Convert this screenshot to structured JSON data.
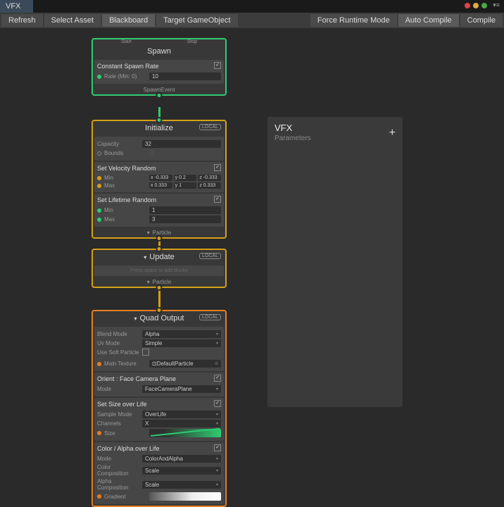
{
  "tab": "VFX",
  "toolbar": {
    "refresh": "Refresh",
    "selectAsset": "Select Asset",
    "blackboard": "Blackboard",
    "targetGO": "Target GameObject",
    "forceRuntime": "Force Runtime Mode",
    "autoCompile": "Auto Compile",
    "compile": "Compile"
  },
  "spawn": {
    "start": "Start",
    "stop": "Stop",
    "title": "Spawn",
    "section": "Constant Spawn Rate",
    "rateLabel": "Rate (Min: 0)",
    "rateVal": "10",
    "footer": "SpawnEvent"
  },
  "init": {
    "title": "Initialize",
    "badge": "LOCAL",
    "capLabel": "Capacity",
    "capVal": "32",
    "boundsLabel": "Bounds",
    "velSection": "Set Velocity Random",
    "min": "Min",
    "max": "Max",
    "vmin": {
      "x": "x -0.333",
      "y": "y 0.2",
      "z": "z -0.333"
    },
    "vmax": {
      "x": "x 0.333",
      "y": "y 1",
      "z": "z 0.333"
    },
    "lifeSection": "Set Lifetime Random",
    "lmin": "1",
    "lmax": "3",
    "footer": "Particle"
  },
  "update": {
    "title": "Update",
    "badge": "LOCAL",
    "footer": "Particle"
  },
  "output": {
    "title": "Quad Output",
    "badge": "LOCAL",
    "blendLabel": "Blend Mode",
    "blendVal": "Alpha",
    "uvLabel": "Uv Mode",
    "uvVal": "Simple",
    "softLabel": "Use Soft Particle",
    "texLabel": "Main Texture",
    "texVal": "DefaultParticle",
    "orientSection": "Orient : Face Camera Plane",
    "modeLabel": "Mode",
    "orientVal": "FaceCameraPlane",
    "sizeSection": "Set Size over Life",
    "sampleLabel": "Sample Mode",
    "sampleVal": "OverLife",
    "chanLabel": "Channels",
    "chanVal": "X",
    "sizeLabel": "Size",
    "colorSection": "Color / Alpha over Life",
    "colorMode": "ColorAndAlpha",
    "colorComp": "Color Composition",
    "alphaComp": "Alpha Composition",
    "scale": "Scale",
    "gradLabel": "Gradient"
  },
  "inspector": {
    "title": "VFX",
    "sub": "Parameters"
  }
}
